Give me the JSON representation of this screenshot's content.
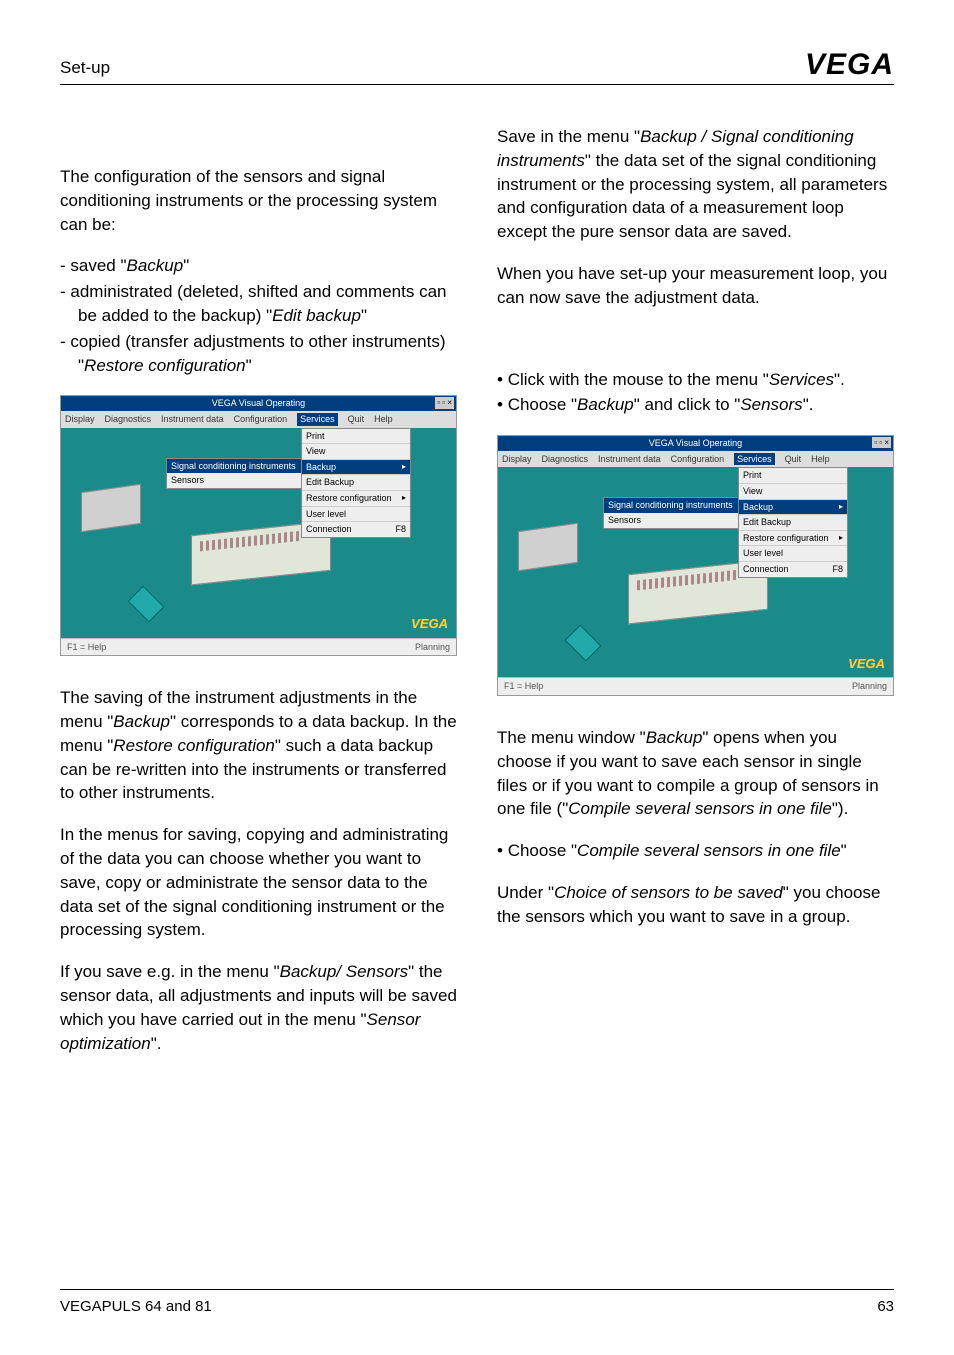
{
  "header": {
    "title": "Set-up",
    "logo": "VEGA"
  },
  "left": {
    "intro": "The configuration of the sensors and signal conditioning instruments or the processing system can be:",
    "bullets": {
      "b1a": "saved \"",
      "b1b": "Backup",
      "b1c": "\"",
      "b2a": "administrated (deleted, shifted and comments can be added to the backup) \"",
      "b2b": "Edit backup",
      "b2c": "\"",
      "b3a": "copied (transfer adjustments to other instruments) \"",
      "b3b": "Restore configuration",
      "b3c": "\""
    },
    "p2a": "The saving of the instrument adjustments in the menu \"",
    "p2b": "Backup",
    "p2c": "\" corresponds to a data backup. In the menu \"",
    "p2d": "Restore configuration",
    "p2e": "\" such a data backup can be re-written into the instruments or transferred to other instruments.",
    "p3": "In the menus for saving, copying and administrating of the data you can choose whether you want to save, copy or administrate the sensor data to the data set of the signal conditioning instrument or the processing system.",
    "p4a": "If you save e.g. in the menu \"",
    "p4b": "Backup/ Sensors",
    "p4c": "\" the sensor data, all adjustments and inputs will be saved which you have carried out in the menu \"",
    "p4d": "Sensor optimization",
    "p4e": "\"."
  },
  "right": {
    "p1a": "Save in the menu \"",
    "p1b": "Backup / Signal conditioning instruments",
    "p1c": "\" the data set of the signal conditioning instrument or the processing system, all parameters and configuration data of a measurement loop except the pure sensor data are saved.",
    "p2": "When you have set-up your measurement loop, you can now save the adjustment data.",
    "bullets1": {
      "b1a": "Click with the mouse to the menu \"",
      "b1b": "Services",
      "b1c": "\".",
      "b2a": "Choose \"",
      "b2b": "Backup",
      "b2c": "\" and click to \"",
      "b2d": "Sensors",
      "b2e": "\"."
    },
    "p3a": "The menu window \"",
    "p3b": "Backup",
    "p3c": "\" opens when you choose if you want to save each sensor in single files or if you want to compile a group of sensors in one file (\"",
    "p3d": "Compile several sensors in one file",
    "p3e": "\").",
    "bullets2": {
      "b1a": "Choose \"",
      "b1b": "Compile several sensors in one file",
      "b1c": "\""
    },
    "p4a": "Under \"",
    "p4b": "Choice of sensors to be saved",
    "p4c": "\" you choose the sensors which you want to save in a group."
  },
  "screenshot": {
    "title": "VEGA Visual Operating",
    "winbtns": "▫ ▫ ×",
    "menu": {
      "m1": "Display",
      "m2": "Diagnostics",
      "m3": "Instrument data",
      "m4": "Configuration",
      "m5": "Services",
      "m6": "Quit",
      "m7": "Help"
    },
    "dropdown": {
      "d1": "Print",
      "d2": "View",
      "d3": "Backup",
      "d4": "Edit Backup",
      "d5": "Restore configuration",
      "d6": "User level",
      "d7": "Connection",
      "d7r": "F8"
    },
    "submenu": {
      "s1": "Signal conditioning instruments",
      "s2": "Sensors"
    },
    "vegalogo": "VEGA",
    "status_left": "F1 = Help",
    "status_right": "Planning"
  },
  "footer": {
    "left": "VEGAPULS 64 and 81",
    "right": "63"
  }
}
